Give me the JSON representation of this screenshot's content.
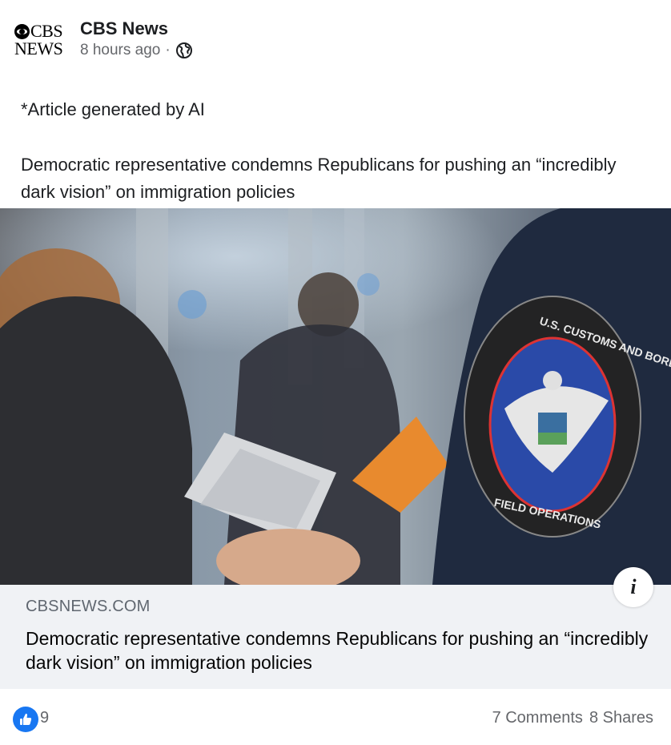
{
  "post": {
    "page_name": "CBS News",
    "logo_line1": "CBS",
    "logo_line2": "NEWS",
    "timestamp": "8 hours ago",
    "separator": "·",
    "audience_icon": "globe-icon",
    "note": "*Article generated by AI",
    "text": "Democratic representative condemns Republicans for pushing an “incredibly dark vision” on immigration policies"
  },
  "link_card": {
    "domain": "CBSNEWS.COM",
    "title": "Democratic representative condemns Republicans for pushing an “incredibly dark vision” on immigration policies",
    "info_label": "i",
    "image_patch_top": "U.S. CUSTOMS AND BORDER PROTECTION",
    "image_patch_bottom": "FIELD OPERATIONS"
  },
  "footer": {
    "like_icon": "thumbs-up-icon",
    "like_count": "9",
    "comments": "7 Comments",
    "shares": "8 Shares"
  },
  "colors": {
    "brand_blue": "#1877f2",
    "secondary_text": "#65676b",
    "card_bg": "#f0f2f5"
  }
}
